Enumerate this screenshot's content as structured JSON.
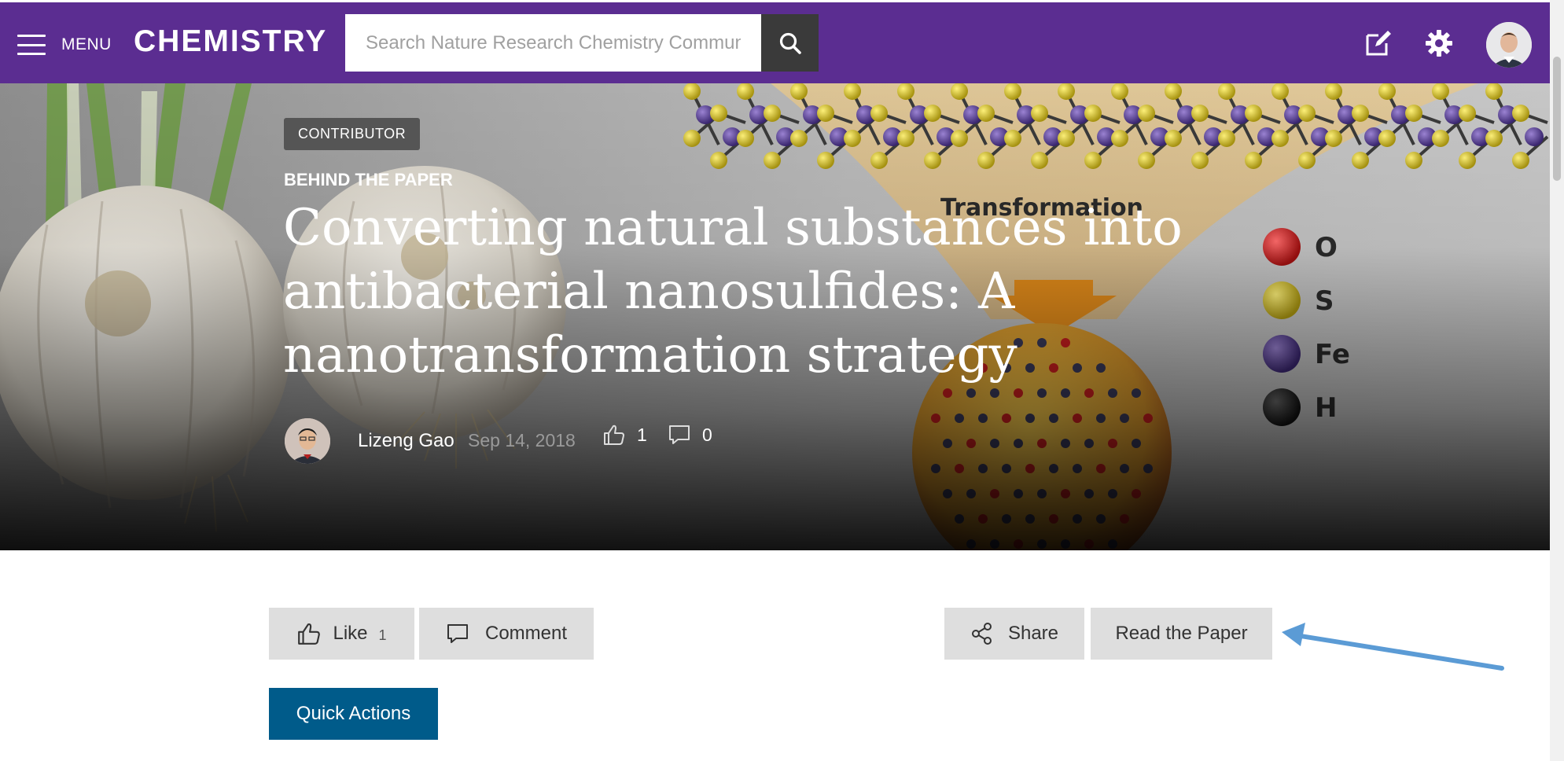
{
  "header": {
    "menu_label": "MENU",
    "brand": "CHEMISTRY",
    "search_placeholder": "Search Nature Research Chemistry Community",
    "icons": [
      "hamburger-icon",
      "search-icon",
      "compose-icon",
      "gear-icon",
      "user-avatar"
    ],
    "bg_color": "#5b2d91"
  },
  "hero": {
    "badge": "CONTRIBUTOR",
    "kicker": "BEHIND THE PAPER",
    "title": "Converting natural substances into antibacterial nanosulfides: A nanotransformation strategy",
    "author": "Lizeng Gao",
    "date": "Sep 14, 2018",
    "like_count": "1",
    "comment_count": "0",
    "figure": {
      "label": "Transformation",
      "legend": [
        {
          "symbol": "O",
          "color": "#c81e1e"
        },
        {
          "symbol": "S",
          "color": "#d4c21a"
        },
        {
          "symbol": "Fe",
          "color": "#5a3f9a"
        },
        {
          "symbol": "H",
          "color": "#2a2a2a"
        }
      ]
    }
  },
  "actions": {
    "like_label": "Like",
    "like_count": "1",
    "comment_label": "Comment",
    "share_label": "Share",
    "read_label": "Read the Paper",
    "quick_label": "Quick Actions",
    "quick_color": "#005b8a",
    "annotation_color": "#5b9bd5"
  }
}
